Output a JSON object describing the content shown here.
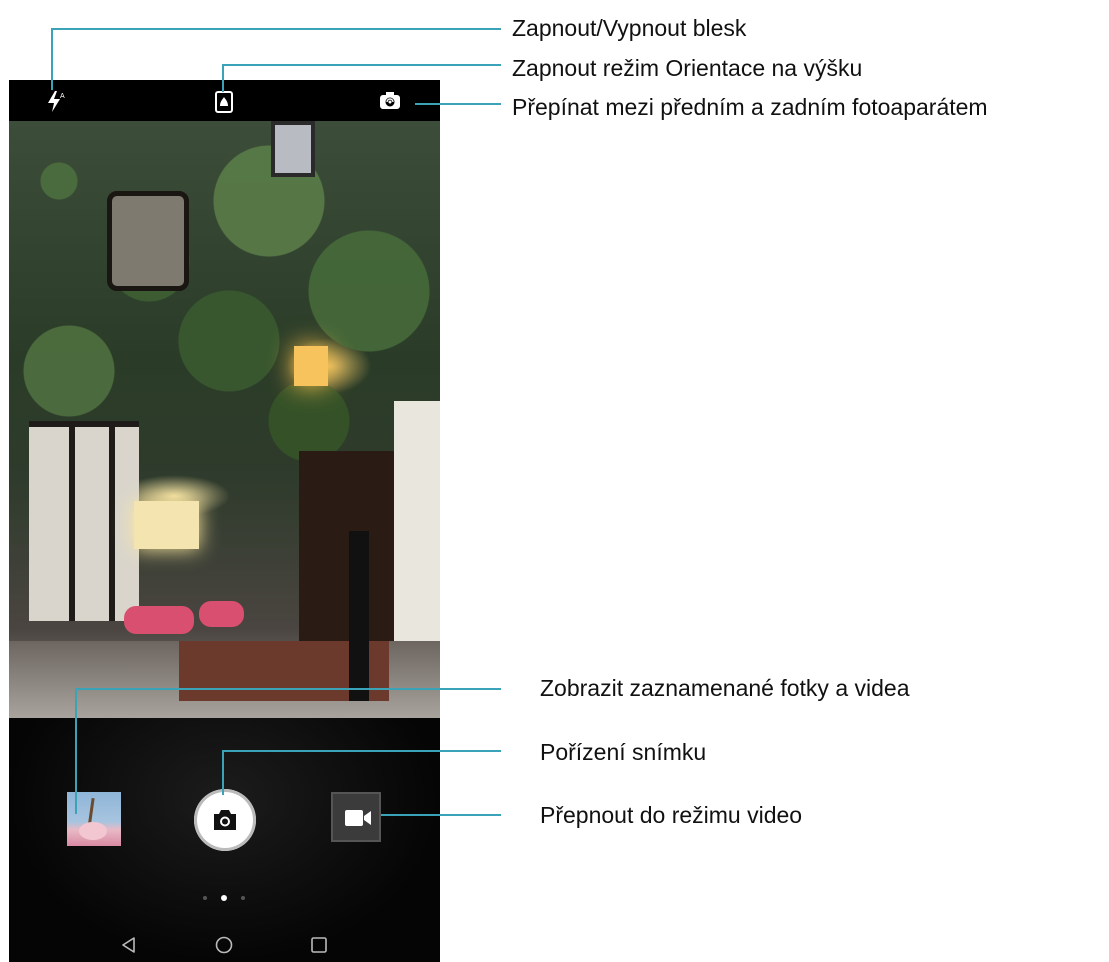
{
  "callouts": {
    "flash": "Zapnout/Vypnout blesk",
    "portrait": "Zapnout režim Orientace na výšku",
    "switch_camera": "Přepínat mezi předním a zadním fotoaparátem",
    "gallery": "Zobrazit zaznamenané fotky a videa",
    "shutter": "Pořízení snímku",
    "video_mode": "Přepnout do režimu video"
  },
  "icons": {
    "flash": "flash-auto-icon",
    "portrait": "portrait-mode-icon",
    "switch_camera": "camera-switch-icon",
    "shutter": "camera-icon",
    "video": "video-camera-icon",
    "back": "nav-back-icon",
    "home": "nav-home-icon",
    "recents": "nav-recents-icon"
  },
  "pager": {
    "count": 3,
    "active": 2
  },
  "colors": {
    "leader": "#3aa3b8",
    "screen_bg": "#000000"
  }
}
